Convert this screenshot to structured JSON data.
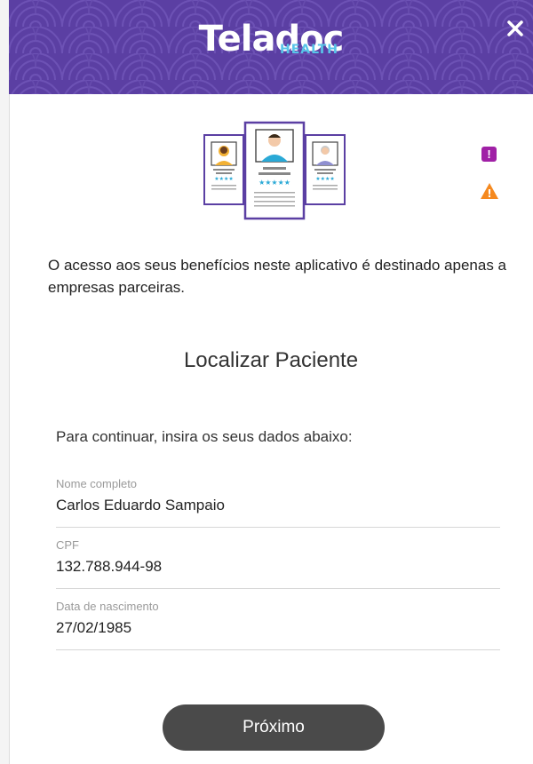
{
  "header": {
    "logo_main": "Teladoc",
    "logo_sub": "HEALTH",
    "close_icon": "close-icon",
    "background_color": "#5b3fa3"
  },
  "illustration": {
    "icon": "doctor-cards-icon"
  },
  "alerts": {
    "info_icon": "exclamation-badge-icon",
    "info_symbol": "!",
    "warning_icon": "warning-triangle-icon",
    "warning_symbol": "!",
    "info_color": "#a020a6",
    "warning_color": "#f5891f"
  },
  "intro_text": "O acesso aos seus benefícios neste aplicativo é destinado apenas a empresas parceiras.",
  "title": "Localizar Paciente",
  "instruction": "Para continuar, insira os seus dados abaixo:",
  "form": {
    "fields": [
      {
        "label": "Nome completo",
        "value": "Carlos Eduardo Sampaio"
      },
      {
        "label": "CPF",
        "value": "132.788.944-98"
      },
      {
        "label": "Data de nascimento",
        "value": "27/02/1985"
      }
    ]
  },
  "next_button": {
    "label": "Próximo",
    "color": "#4a4a4a"
  }
}
